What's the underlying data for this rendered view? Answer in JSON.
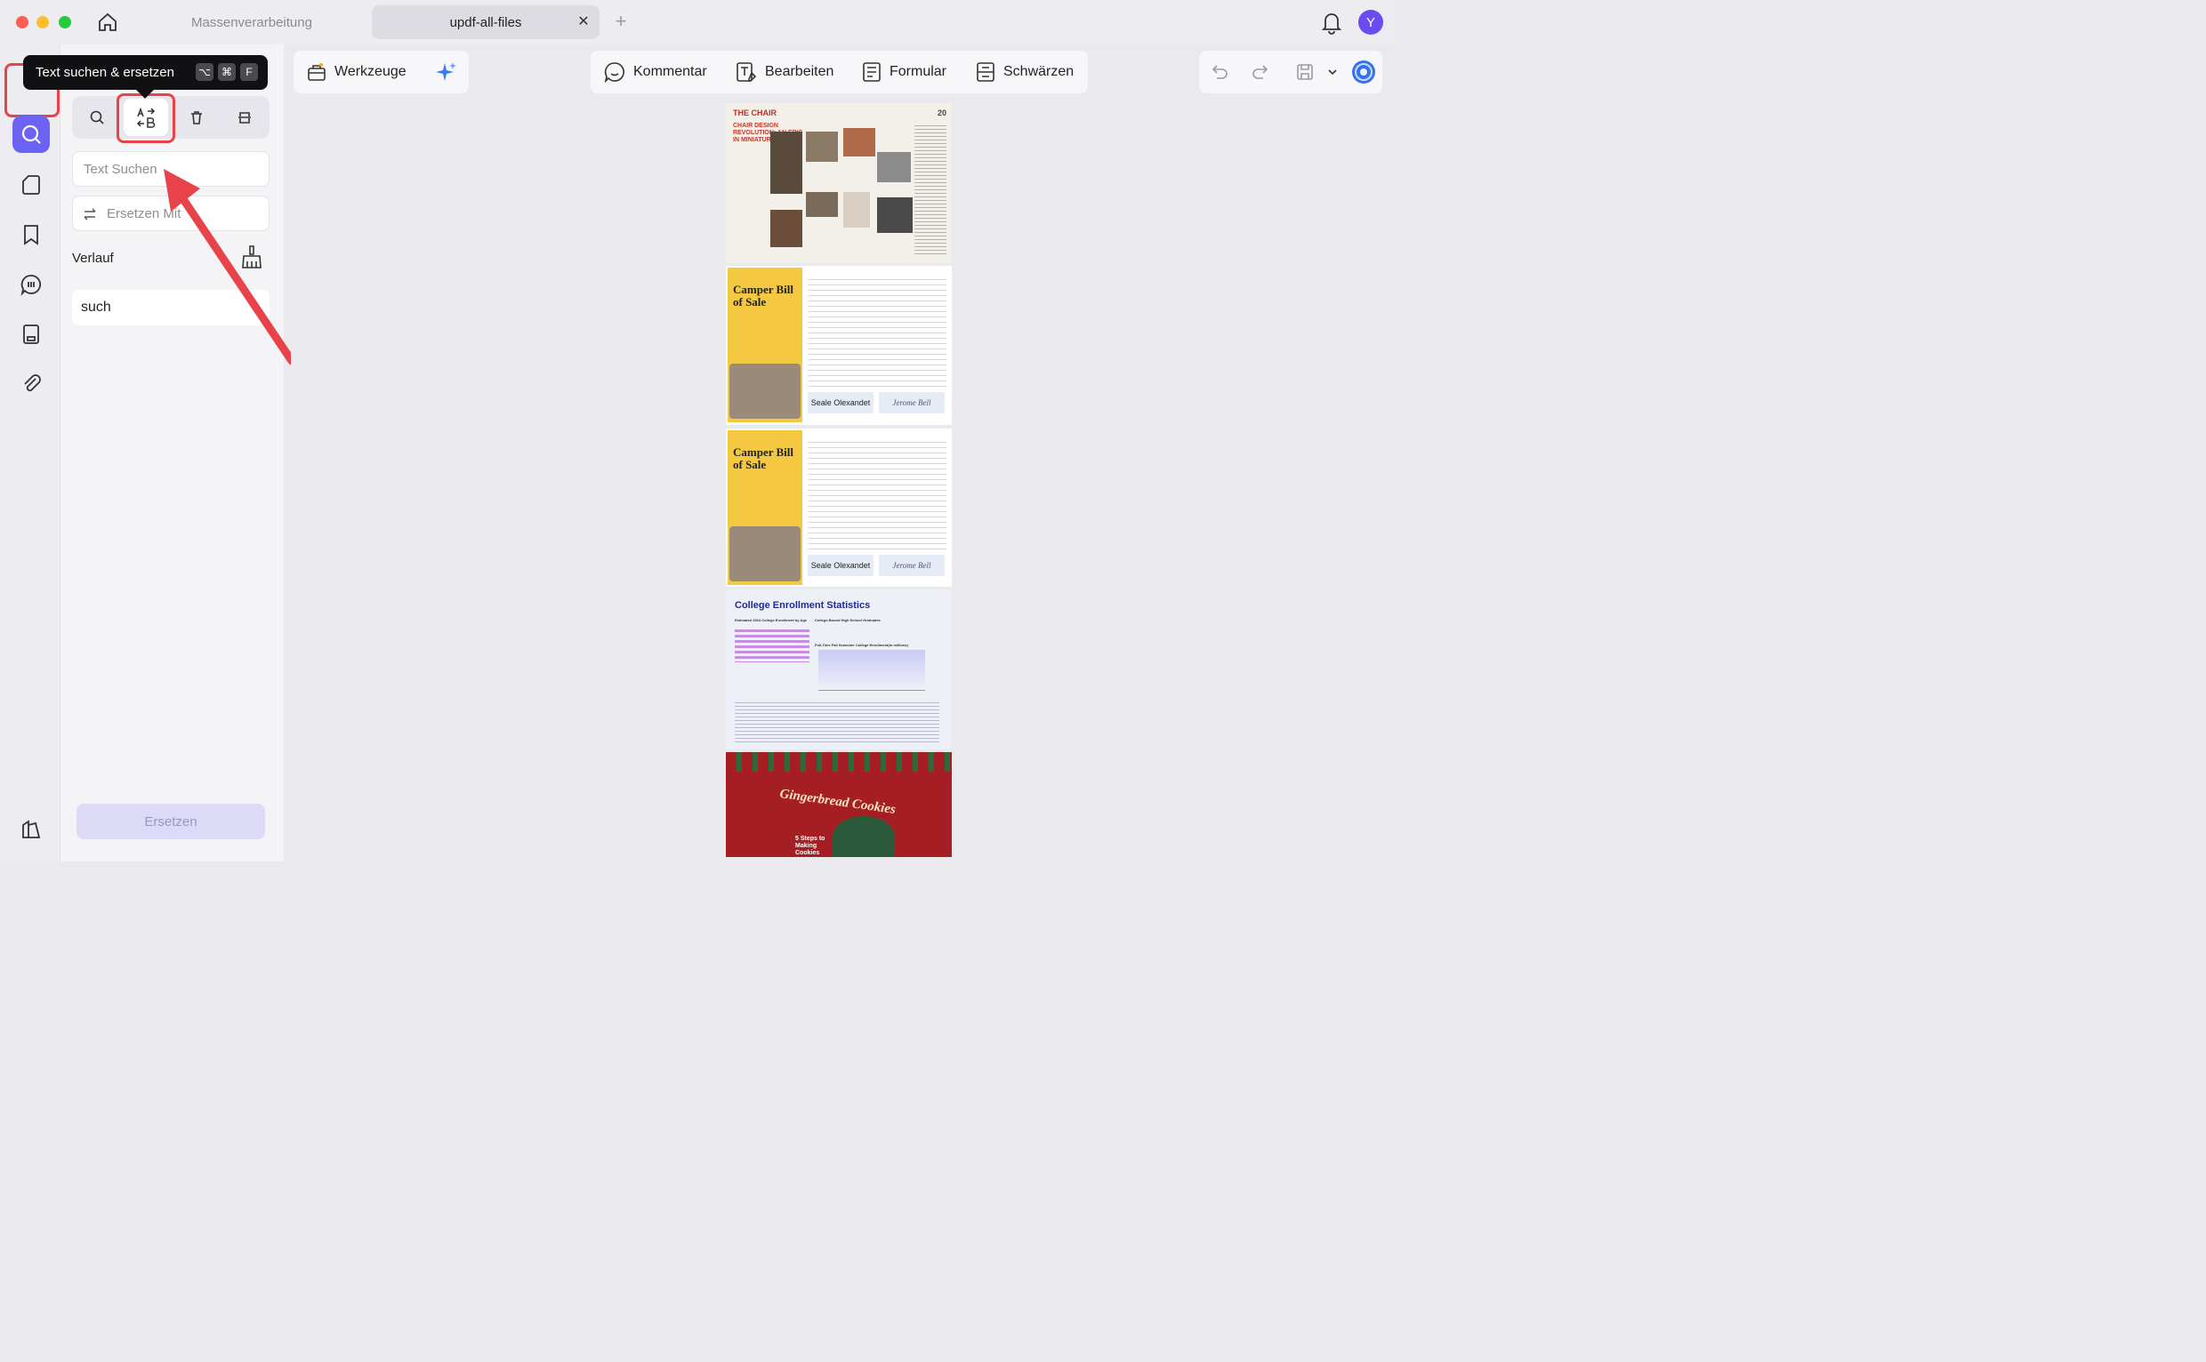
{
  "window": {
    "tabs": [
      {
        "label": "Massenverarbeitung",
        "active": false
      },
      {
        "label": "updf-all-files",
        "active": true
      }
    ],
    "avatar_letter": "Y"
  },
  "tooltip": {
    "text": "Text suchen & ersetzen",
    "keys": [
      "⌥",
      "⌘",
      "F"
    ]
  },
  "panel": {
    "search_placeholder": "Text Suchen",
    "replace_placeholder": "Ersetzen Mit",
    "history_label": "Verlauf",
    "history_items": [
      "such"
    ],
    "replace_button": "Ersetzen"
  },
  "toolbar": {
    "tools_label": "Werkzeuge",
    "comment_label": "Kommentar",
    "edit_label": "Bearbeiten",
    "form_label": "Formular",
    "redact_label": "Schwärzen"
  },
  "pages": {
    "p1": {
      "title": "THE CHAIR",
      "headline": "CHAIR DESIGN REVOLUTION: AN EPIC IN MINIATURE",
      "number": "20"
    },
    "p2": {
      "title": "Camper Bill of Sale",
      "seller_sig": "Seale Olexandet",
      "buyer_sig": "Jerome Bell"
    },
    "p3": {
      "title": "Camper Bill of Sale",
      "seller_sig": "Seale Olexandet",
      "buyer_sig": "Jerome Bell"
    },
    "p4": {
      "title": "College Enrollment Statistics",
      "sub1": "Estimated 2024 College Enrollment by Age",
      "sub2": "College-Bound High School Graduates",
      "sub3": "Full-Time Fall Semester College Enrollment(in millions)"
    },
    "p5": {
      "title": "Gingerbread Cookies",
      "sub": "5 Steps to Making Cookies"
    }
  },
  "colors": {
    "accent": "#6c63f5",
    "highlight": "#e8434a"
  }
}
